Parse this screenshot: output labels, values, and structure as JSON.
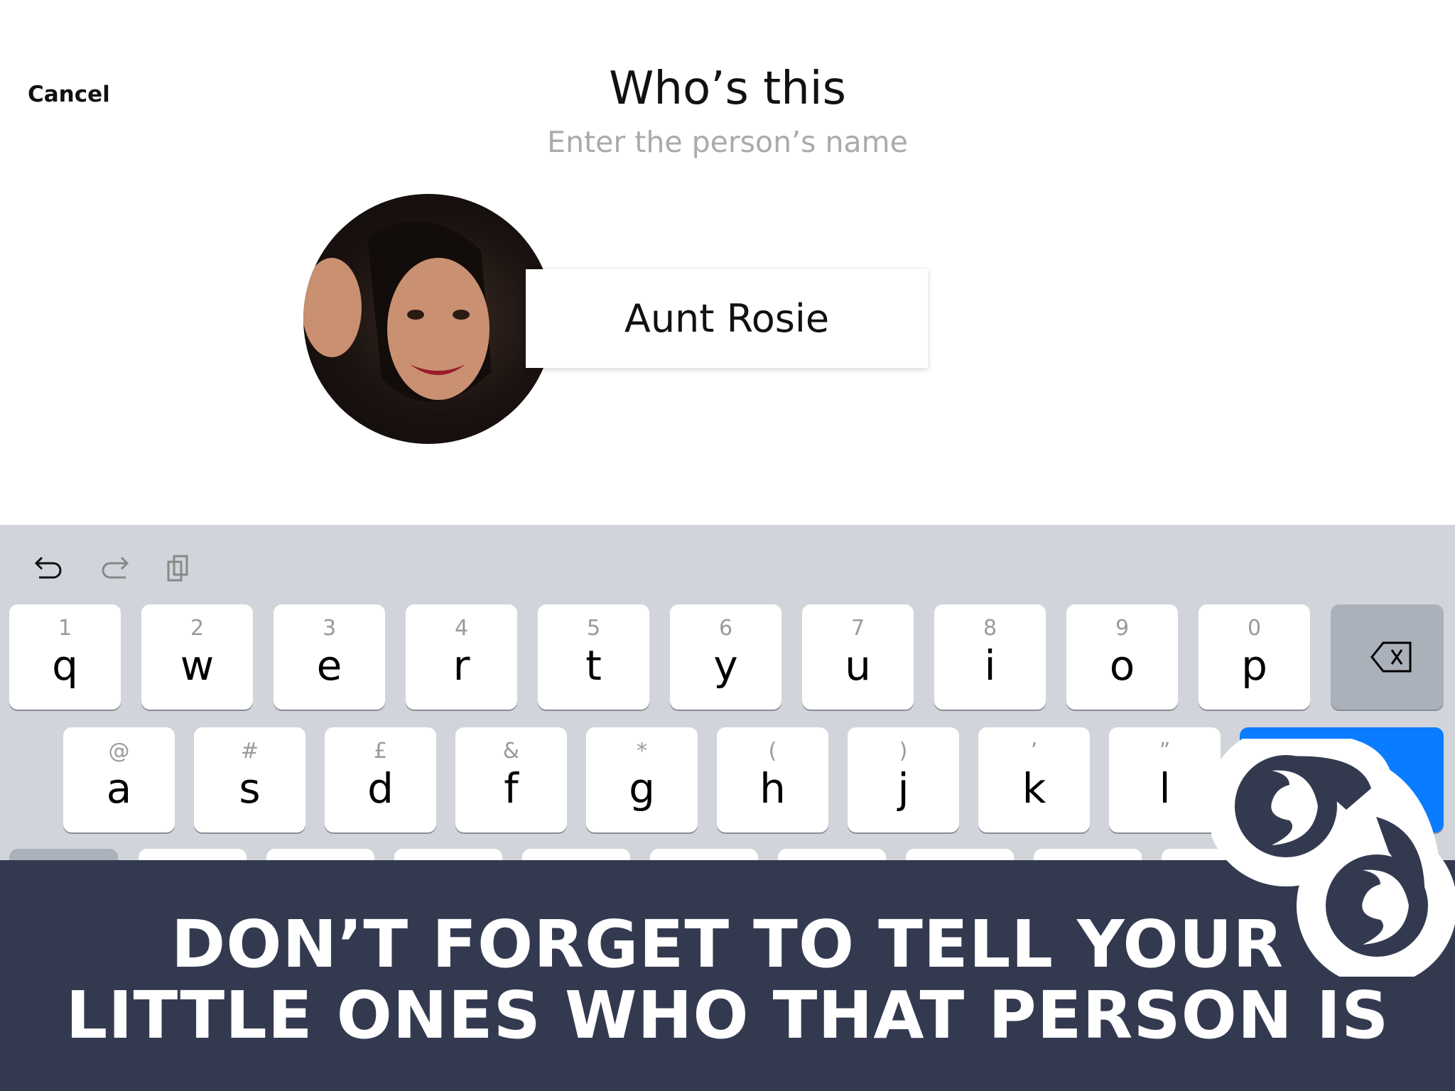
{
  "header": {
    "cancel_label": "Cancel",
    "title": "Who’s this",
    "subtitle": "Enter the person’s name"
  },
  "name_field": {
    "value": "Aunt Rosie"
  },
  "keyboard": {
    "toolbar": [
      "undo-icon",
      "redo-icon",
      "paste-icon"
    ],
    "row1": [
      {
        "main": "q",
        "alt": "1"
      },
      {
        "main": "w",
        "alt": "2"
      },
      {
        "main": "e",
        "alt": "3"
      },
      {
        "main": "r",
        "alt": "4"
      },
      {
        "main": "t",
        "alt": "5"
      },
      {
        "main": "y",
        "alt": "6"
      },
      {
        "main": "u",
        "alt": "7"
      },
      {
        "main": "i",
        "alt": "8"
      },
      {
        "main": "o",
        "alt": "9"
      },
      {
        "main": "p",
        "alt": "0"
      }
    ],
    "row2": [
      {
        "main": "a",
        "alt": "@"
      },
      {
        "main": "s",
        "alt": "#"
      },
      {
        "main": "d",
        "alt": "£"
      },
      {
        "main": "f",
        "alt": "&"
      },
      {
        "main": "g",
        "alt": "*"
      },
      {
        "main": "h",
        "alt": "("
      },
      {
        "main": "j",
        "alt": ")"
      },
      {
        "main": "k",
        "alt": "’"
      },
      {
        "main": "l",
        "alt": "”"
      }
    ],
    "return_color": "#0a7cff"
  },
  "banner": {
    "line1": "DON’T FORGET TO TELL YOUR",
    "line2": "LITTLE ONES WHO THAT PERSON IS",
    "color": "#333a50"
  }
}
